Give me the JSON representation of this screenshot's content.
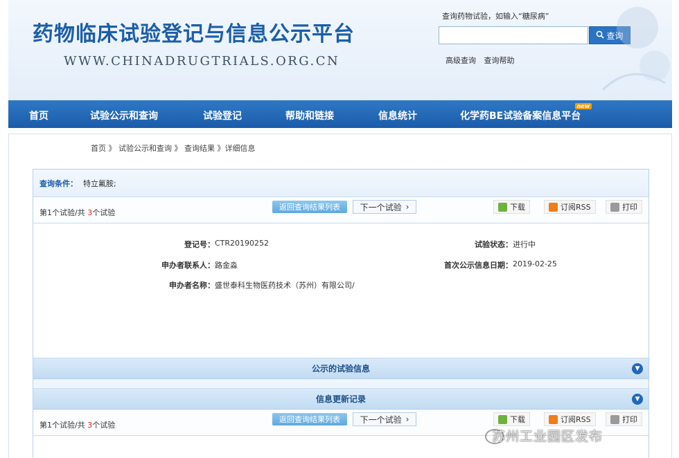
{
  "header": {
    "title": "药物临床试验登记与信息公示平台",
    "url": "WWW.CHINADRUGTRIALS.ORG.CN",
    "search_hint": "查询药物试验，如输入“糖尿病”",
    "search_value": "",
    "search_button": "查询",
    "advanced_search": "高级查询",
    "search_help": "查询帮助"
  },
  "nav": {
    "items": [
      "首页",
      "试验公示和查询",
      "试验登记",
      "帮助和链接",
      "信息统计",
      "化学药BE试验备案信息平台"
    ],
    "badge": "new"
  },
  "breadcrumb": "首页 》 试验公示和查询 》 查询结果 》详细信息",
  "query": {
    "label": "查询条件：",
    "value": "特立氟胺;"
  },
  "result_count": {
    "prefix": "第1个试验/共 ",
    "total": "3",
    "suffix": "个试验"
  },
  "buttons": {
    "back_to_list": "返回查询结果列表",
    "next_trial": "下一个试验",
    "download": "下载",
    "rss": "订阅RSS",
    "print": "打印"
  },
  "details": {
    "reg_no_label": "登记号：",
    "reg_no": "CTR20190252",
    "status_label": "试验状态：",
    "status": "进行中",
    "contact_label": "申办者联系人：",
    "contact": "路金淼",
    "first_pub_label": "首次公示信息日期：",
    "first_pub_date": "2019-02-25",
    "sponsor_label": "申办者名称：",
    "sponsor": "盛世泰科生物医药技术（苏州）有限公司/"
  },
  "sections": {
    "published_info": "公示的试验信息",
    "update_log": "信息更新记录"
  },
  "watermark": "苏州工业园区发布",
  "colors": {
    "brand_blue": "#1c5ea8",
    "nav_blue": "#2067b8",
    "count_red": "#dd2222"
  }
}
